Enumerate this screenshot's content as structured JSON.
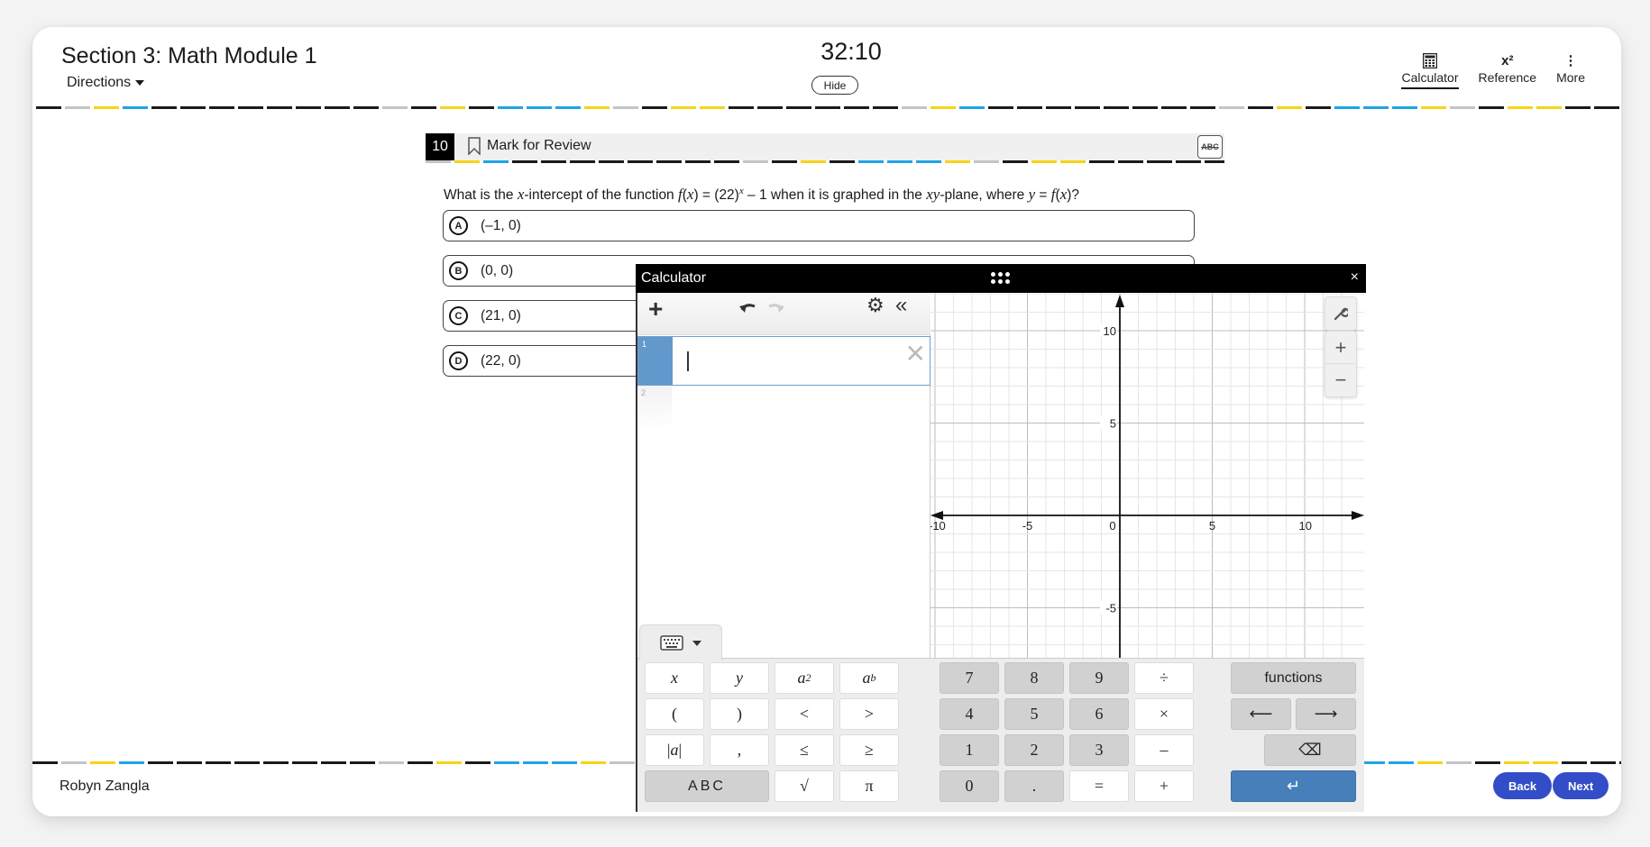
{
  "header": {
    "section_title": "Section 3: Math Module 1",
    "directions_label": "Directions",
    "timer": "32:10",
    "hide_label": "Hide",
    "tools": [
      {
        "label": "Calculator",
        "icon": "calculator-icon",
        "active": true
      },
      {
        "label": "Reference",
        "icon": "x-squared-icon",
        "glyph": "x²",
        "active": false
      },
      {
        "label": "More",
        "icon": "more-vertical-icon",
        "glyph": "⋮",
        "active": false
      }
    ]
  },
  "divider_colors": {
    "black": "#1a1a1a",
    "gray": "#c4c4c4",
    "yellow": "#f6d417",
    "blue": "#1ea4e6",
    "pattern": [
      "K",
      "G",
      "Y",
      "B",
      "K",
      "K",
      "K",
      "K",
      "K",
      "K",
      "K",
      "K",
      "G",
      "K",
      "Y",
      "K",
      "B",
      "B",
      "B",
      "Y",
      "G",
      "K",
      "Y",
      "Y",
      "K",
      "K",
      "K",
      "K",
      "K"
    ]
  },
  "question": {
    "number": "10",
    "mark_for_review_label": "Mark for Review",
    "abc_label": "ABC",
    "text_parts": {
      "p1": "What is the ",
      "x1": "x",
      "p2": "-intercept of the function ",
      "f": "f",
      "p3": "(",
      "x2": "x",
      "p4": ") = (22)",
      "sup": "x",
      "p5": " – 1 when it is graphed in the ",
      "xy": "xy",
      "p6": "-plane, where ",
      "y": "y",
      "p7": " = ",
      "f2": "f",
      "p8": "(",
      "x3": "x",
      "p9": ")?"
    },
    "choices": [
      {
        "letter": "A",
        "text": "(–1, 0)"
      },
      {
        "letter": "B",
        "text": "(0, 0)"
      },
      {
        "letter": "C",
        "text": "(21, 0)"
      },
      {
        "letter": "D",
        "text": "(22, 0)"
      }
    ]
  },
  "footer": {
    "user_name": "Robyn Zangla",
    "back_label": "Back",
    "next_label": "Next",
    "button_color": "#324dc7"
  },
  "calculator": {
    "title": "Calculator",
    "close_label": "×",
    "expressions": [
      {
        "index": "1",
        "value": ""
      },
      {
        "index": "2",
        "value": ""
      }
    ],
    "graph": {
      "x_range": [
        -10,
        10
      ],
      "y_range": [
        -5,
        10
      ],
      "x_tick_labels": [
        "-10",
        "-5",
        "0",
        "5",
        "10"
      ],
      "y_tick_labels": [
        "10",
        "5",
        "-5"
      ],
      "zoom_in_label": "+",
      "zoom_out_label": "−"
    },
    "keypad": {
      "left": [
        [
          "x",
          "y",
          "a²",
          "aᵇ"
        ],
        [
          "(",
          ")",
          "<",
          ">"
        ],
        [
          "|a|",
          ",",
          "≤",
          "≥"
        ],
        [
          "ABC",
          "√",
          "π"
        ]
      ],
      "numbers": [
        [
          "7",
          "8",
          "9",
          "÷"
        ],
        [
          "4",
          "5",
          "6",
          "×"
        ],
        [
          "1",
          "2",
          "3",
          "–"
        ],
        [
          "0",
          ".",
          "=",
          "+"
        ]
      ],
      "functions_label": "functions",
      "left_arrow": "⟵",
      "right_arrow": "⟶",
      "backspace": "⌫",
      "enter": "↵",
      "enter_color": "#467fb9"
    }
  }
}
